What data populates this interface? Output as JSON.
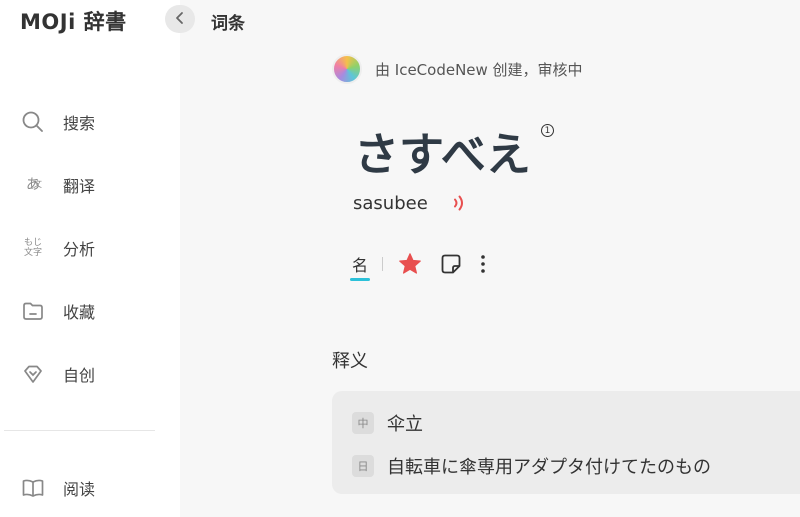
{
  "app": {
    "logo": "MOJi 辞書"
  },
  "header": {
    "title": "词条"
  },
  "sidebar": {
    "items": [
      {
        "label": "搜索",
        "icon": "search-icon"
      },
      {
        "label": "翻译",
        "icon": "translate-icon",
        "icon_text": "あ",
        "icon_sub": "文"
      },
      {
        "label": "分析",
        "icon": "analysis-icon",
        "icon_text": "もじ",
        "icon_sub": "文字"
      },
      {
        "label": "收藏",
        "icon": "folder-icon"
      },
      {
        "label": "自创",
        "icon": "diamond-icon"
      },
      {
        "label": "阅读",
        "icon": "book-icon"
      }
    ]
  },
  "entry": {
    "creator_text": "由 IceCodeNew 创建，审核中",
    "word": "さすべえ",
    "pitch": "1",
    "romaji": "sasubee",
    "pos": "名",
    "accent_color": "#2cc1d9",
    "star_color": "#e84f4f",
    "audio_color": "#e84f4f"
  },
  "definitions": {
    "title": "释义",
    "items": [
      {
        "lang": "中",
        "text": "伞立"
      },
      {
        "lang": "日",
        "text": "自転車に傘専用アダプタ付けてたのもの"
      }
    ]
  }
}
